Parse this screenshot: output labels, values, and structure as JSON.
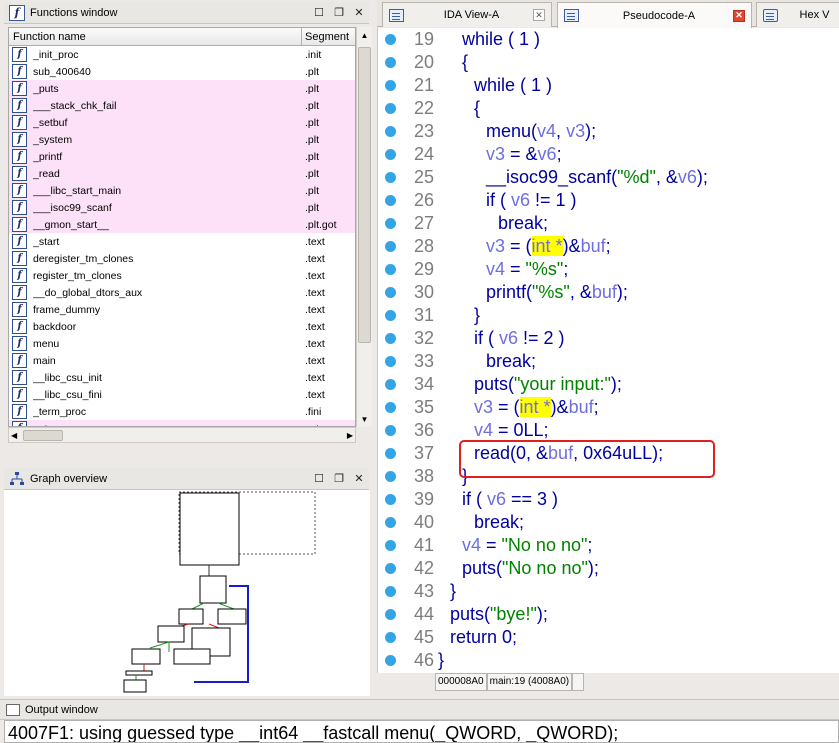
{
  "functions_window": {
    "title": "Functions window",
    "col_name": "Function name",
    "col_segment": "Segment",
    "rows": [
      {
        "name": "_init_proc",
        "segment": ".init",
        "pink": false
      },
      {
        "name": "sub_400640",
        "segment": ".plt",
        "pink": false
      },
      {
        "name": "_puts",
        "segment": ".plt",
        "pink": true
      },
      {
        "name": "___stack_chk_fail",
        "segment": ".plt",
        "pink": true
      },
      {
        "name": "_setbuf",
        "segment": ".plt",
        "pink": true
      },
      {
        "name": "_system",
        "segment": ".plt",
        "pink": true
      },
      {
        "name": "_printf",
        "segment": ".plt",
        "pink": true
      },
      {
        "name": "_read",
        "segment": ".plt",
        "pink": true
      },
      {
        "name": "___libc_start_main",
        "segment": ".plt",
        "pink": true
      },
      {
        "name": "___isoc99_scanf",
        "segment": ".plt",
        "pink": true
      },
      {
        "name": "__gmon_start__",
        "segment": ".plt.got",
        "pink": true
      },
      {
        "name": "_start",
        "segment": ".text",
        "pink": false
      },
      {
        "name": "deregister_tm_clones",
        "segment": ".text",
        "pink": false
      },
      {
        "name": "register_tm_clones",
        "segment": ".text",
        "pink": false
      },
      {
        "name": "__do_global_dtors_aux",
        "segment": ".text",
        "pink": false
      },
      {
        "name": "frame_dummy",
        "segment": ".text",
        "pink": false
      },
      {
        "name": "backdoor",
        "segment": ".text",
        "pink": false
      },
      {
        "name": "menu",
        "segment": ".text",
        "pink": false
      },
      {
        "name": "main",
        "segment": ".text",
        "pink": false
      },
      {
        "name": "__libc_csu_init",
        "segment": ".text",
        "pink": false
      },
      {
        "name": "__libc_csu_fini",
        "segment": ".text",
        "pink": false
      },
      {
        "name": "_term_proc",
        "segment": ".fini",
        "pink": false
      },
      {
        "name": "puts",
        "segment": "extern",
        "pink": true
      }
    ]
  },
  "graph_overview": {
    "title": "Graph overview"
  },
  "tabs": [
    {
      "label": "IDA View-A",
      "active": false
    },
    {
      "label": "Pseudocode-A",
      "active": true
    },
    {
      "label": "Hex V",
      "active": false
    }
  ],
  "code_lines": [
    {
      "n": "19",
      "indent": 1,
      "tokens": [
        [
          "kw",
          "while ( 1 )"
        ]
      ]
    },
    {
      "n": "20",
      "indent": 1,
      "tokens": [
        [
          "kw",
          "{"
        ]
      ]
    },
    {
      "n": "21",
      "indent": 2,
      "tokens": [
        [
          "kw",
          "while ( 1 )"
        ]
      ]
    },
    {
      "n": "22",
      "indent": 2,
      "tokens": [
        [
          "kw",
          "{"
        ]
      ]
    },
    {
      "n": "23",
      "indent": 3,
      "tokens": [
        [
          "kw",
          "menu("
        ],
        [
          "var",
          "v4"
        ],
        [
          "kw",
          ", "
        ],
        [
          "var",
          "v3"
        ],
        [
          "kw",
          ");"
        ]
      ]
    },
    {
      "n": "24",
      "indent": 3,
      "tokens": [
        [
          "var",
          "v3"
        ],
        [
          "kw",
          " = &"
        ],
        [
          "var",
          "v6"
        ],
        [
          "kw",
          ";"
        ]
      ]
    },
    {
      "n": "25",
      "indent": 3,
      "tokens": [
        [
          "kw",
          "__isoc99_scanf("
        ],
        [
          "str",
          "\"%d\""
        ],
        [
          "kw",
          ", &"
        ],
        [
          "var",
          "v6"
        ],
        [
          "kw",
          ");"
        ]
      ]
    },
    {
      "n": "26",
      "indent": 3,
      "tokens": [
        [
          "kw",
          "if ( "
        ],
        [
          "var",
          "v6"
        ],
        [
          "kw",
          " != 1 )"
        ]
      ]
    },
    {
      "n": "27",
      "indent": 4,
      "tokens": [
        [
          "kw",
          "break;"
        ]
      ]
    },
    {
      "n": "28",
      "indent": 3,
      "tokens": [
        [
          "var",
          "v3"
        ],
        [
          "kw",
          " = ("
        ],
        [
          "hl",
          "int *"
        ],
        [
          "kw",
          ")&"
        ],
        [
          "var",
          "buf"
        ],
        [
          "kw",
          ";"
        ]
      ]
    },
    {
      "n": "29",
      "indent": 3,
      "tokens": [
        [
          "var",
          "v4"
        ],
        [
          "kw",
          " = "
        ],
        [
          "str",
          "\"%s\""
        ],
        [
          "kw",
          ";"
        ]
      ]
    },
    {
      "n": "30",
      "indent": 3,
      "tokens": [
        [
          "kw",
          "printf("
        ],
        [
          "str",
          "\"%s\""
        ],
        [
          "kw",
          ", &"
        ],
        [
          "var",
          "buf"
        ],
        [
          "kw",
          ");"
        ]
      ]
    },
    {
      "n": "31",
      "indent": 2,
      "tokens": [
        [
          "kw",
          "}"
        ]
      ]
    },
    {
      "n": "32",
      "indent": 2,
      "tokens": [
        [
          "kw",
          "if ( "
        ],
        [
          "var",
          "v6"
        ],
        [
          "kw",
          " != 2 )"
        ]
      ]
    },
    {
      "n": "33",
      "indent": 3,
      "tokens": [
        [
          "kw",
          "break;"
        ]
      ]
    },
    {
      "n": "34",
      "indent": 2,
      "tokens": [
        [
          "kw",
          "puts("
        ],
        [
          "str",
          "\"your input:\""
        ],
        [
          "kw",
          ");"
        ]
      ]
    },
    {
      "n": "35",
      "indent": 2,
      "tokens": [
        [
          "var",
          "v3"
        ],
        [
          "kw",
          " = ("
        ],
        [
          "hl",
          "int *"
        ],
        [
          "kw",
          ")&"
        ],
        [
          "var",
          "buf"
        ],
        [
          "kw",
          ";"
        ]
      ]
    },
    {
      "n": "36",
      "indent": 2,
      "tokens": [
        [
          "var",
          "v4"
        ],
        [
          "kw",
          " = 0LL;"
        ]
      ]
    },
    {
      "n": "37",
      "indent": 2,
      "tokens": [
        [
          "kw",
          "read(0, &"
        ],
        [
          "var",
          "buf"
        ],
        [
          "kw",
          ", 0x64uLL);"
        ]
      ]
    },
    {
      "n": "38",
      "indent": 1,
      "tokens": [
        [
          "kw",
          "}"
        ]
      ]
    },
    {
      "n": "39",
      "indent": 1,
      "tokens": [
        [
          "kw",
          "if ( "
        ],
        [
          "var",
          "v6"
        ],
        [
          "kw",
          " == 3 )"
        ]
      ]
    },
    {
      "n": "40",
      "indent": 2,
      "tokens": [
        [
          "kw",
          "break;"
        ]
      ]
    },
    {
      "n": "41",
      "indent": 1,
      "tokens": [
        [
          "var",
          "v4"
        ],
        [
          "kw",
          " = "
        ],
        [
          "str",
          "\"No no no\""
        ],
        [
          "kw",
          ";"
        ]
      ]
    },
    {
      "n": "42",
      "indent": 1,
      "tokens": [
        [
          "kw",
          "puts("
        ],
        [
          "str",
          "\"No no no\""
        ],
        [
          "kw",
          ");"
        ]
      ]
    },
    {
      "n": "43",
      "indent": 0,
      "tokens": [
        [
          "kw",
          "}"
        ]
      ]
    },
    {
      "n": "44",
      "indent": 0,
      "tokens": [
        [
          "kw",
          "puts("
        ],
        [
          "str",
          "\"bye!\""
        ],
        [
          "kw",
          ");"
        ]
      ]
    },
    {
      "n": "45",
      "indent": 0,
      "tokens": [
        [
          "kw",
          "return 0;"
        ]
      ]
    },
    {
      "n": "46",
      "indent": -1,
      "tokens": [
        [
          "kw",
          "}"
        ]
      ]
    }
  ],
  "status_bar": {
    "address": "000008A0",
    "location": "main:19 (4008A0)"
  },
  "output_window": {
    "title": "Output window",
    "text": "4007F1: using guessed type __int64 __fastcall menu(_QWORD, _QWORD);"
  },
  "colors": {
    "keyword": "#0000a0",
    "variable": "#6e6ee0",
    "string": "#008200",
    "highlight": "#ffff00",
    "breakpoint_dot": "#33a5e6",
    "annotation_box": "#e0201e",
    "library_row": "#fce1f8"
  }
}
